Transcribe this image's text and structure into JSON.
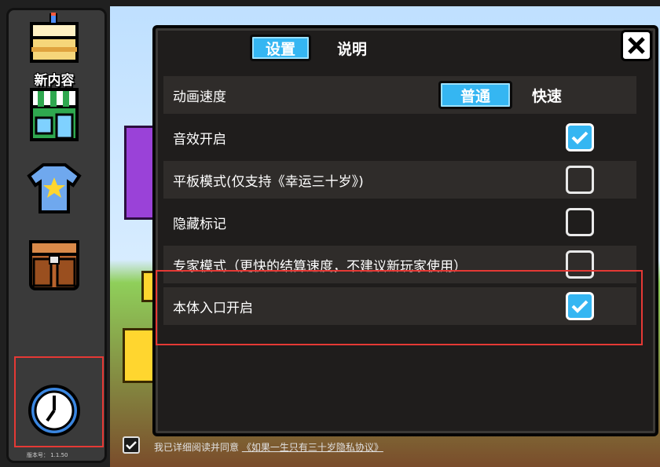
{
  "sidebar": {
    "items": [
      {
        "label": "新内容",
        "icon": "cake-icon"
      },
      {
        "label": "",
        "icon": "shop-icon"
      },
      {
        "label": "",
        "icon": "tshirt-icon"
      },
      {
        "label": "",
        "icon": "backpack-icon"
      },
      {
        "label": "",
        "icon": "clock-icon"
      }
    ],
    "version": "版本号： 1.1.50"
  },
  "dialog": {
    "tabs": [
      {
        "label": "设置",
        "active": true
      },
      {
        "label": "说明",
        "active": false
      }
    ],
    "close_icon": "close-icon",
    "speed": {
      "label": "动画速度",
      "options": [
        "普通",
        "快速"
      ],
      "selected": "普通"
    },
    "settings": [
      {
        "label": "音效开启",
        "checked": true
      },
      {
        "label": "平板模式(仅支持《幸运三十岁》)",
        "checked": false
      },
      {
        "label": "隐藏标记",
        "checked": false
      },
      {
        "label": "专家模式（更快的结算速度，不建议新玩家使用）",
        "checked": false
      },
      {
        "label": "本体入口开启",
        "checked": true
      }
    ]
  },
  "agreement": {
    "checked": true,
    "text": "我已详细阅读并同意",
    "link": "《如果一生只有三十岁隐私协议》"
  },
  "colors": {
    "accent": "#35b6f2",
    "highlight": "#e53935",
    "panel": "#1f1d1c",
    "row_dark": "#2f2c2a"
  }
}
